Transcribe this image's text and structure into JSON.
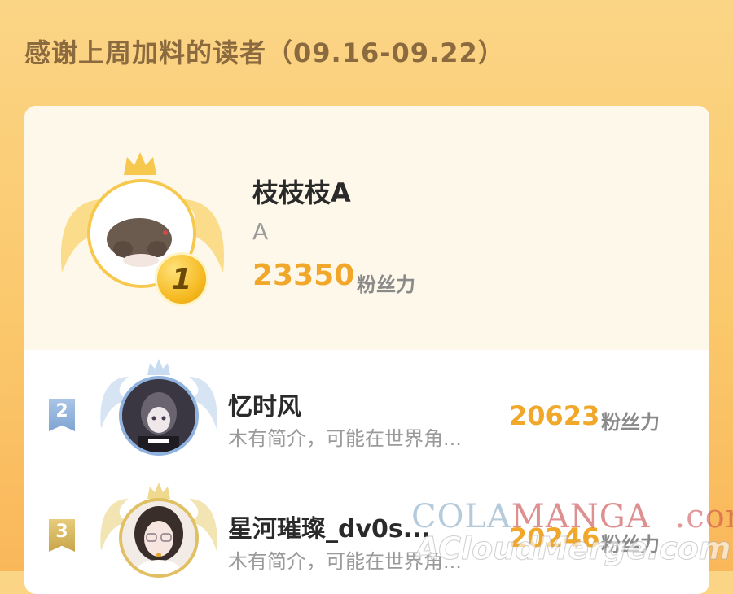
{
  "header": {
    "title": "感谢上周加料的读者（09.16-09.22）"
  },
  "top_reader": {
    "rank": "1",
    "name": "枝枝枝A",
    "bio": "A",
    "score": "23350",
    "score_unit": "粉丝力"
  },
  "readers": [
    {
      "rank": "2",
      "name": "忆时风",
      "bio": "木有简介，可能在世界角...",
      "score": "20623",
      "score_unit": "粉丝力"
    },
    {
      "rank": "3",
      "name": "星河璀璨_dv0s...",
      "bio": "木有简介，可能在世界角...",
      "score": "20246",
      "score_unit": "粉丝力"
    }
  ],
  "watermark": {
    "brand_part1": "COLA",
    "brand_part2": "MANGA",
    "brand_tld": ".com",
    "sub": "ACloudMerge.com"
  },
  "colors": {
    "background": "#fbc86c",
    "accent_score": "#f0a72a",
    "rank1_gold": "#f5b81e",
    "rank2_blue": "#8fb2de",
    "rank3_gold": "#c7a54a"
  },
  "icons": [
    "crown-icon",
    "wing-icon",
    "rank-badge-icon",
    "avatar"
  ]
}
